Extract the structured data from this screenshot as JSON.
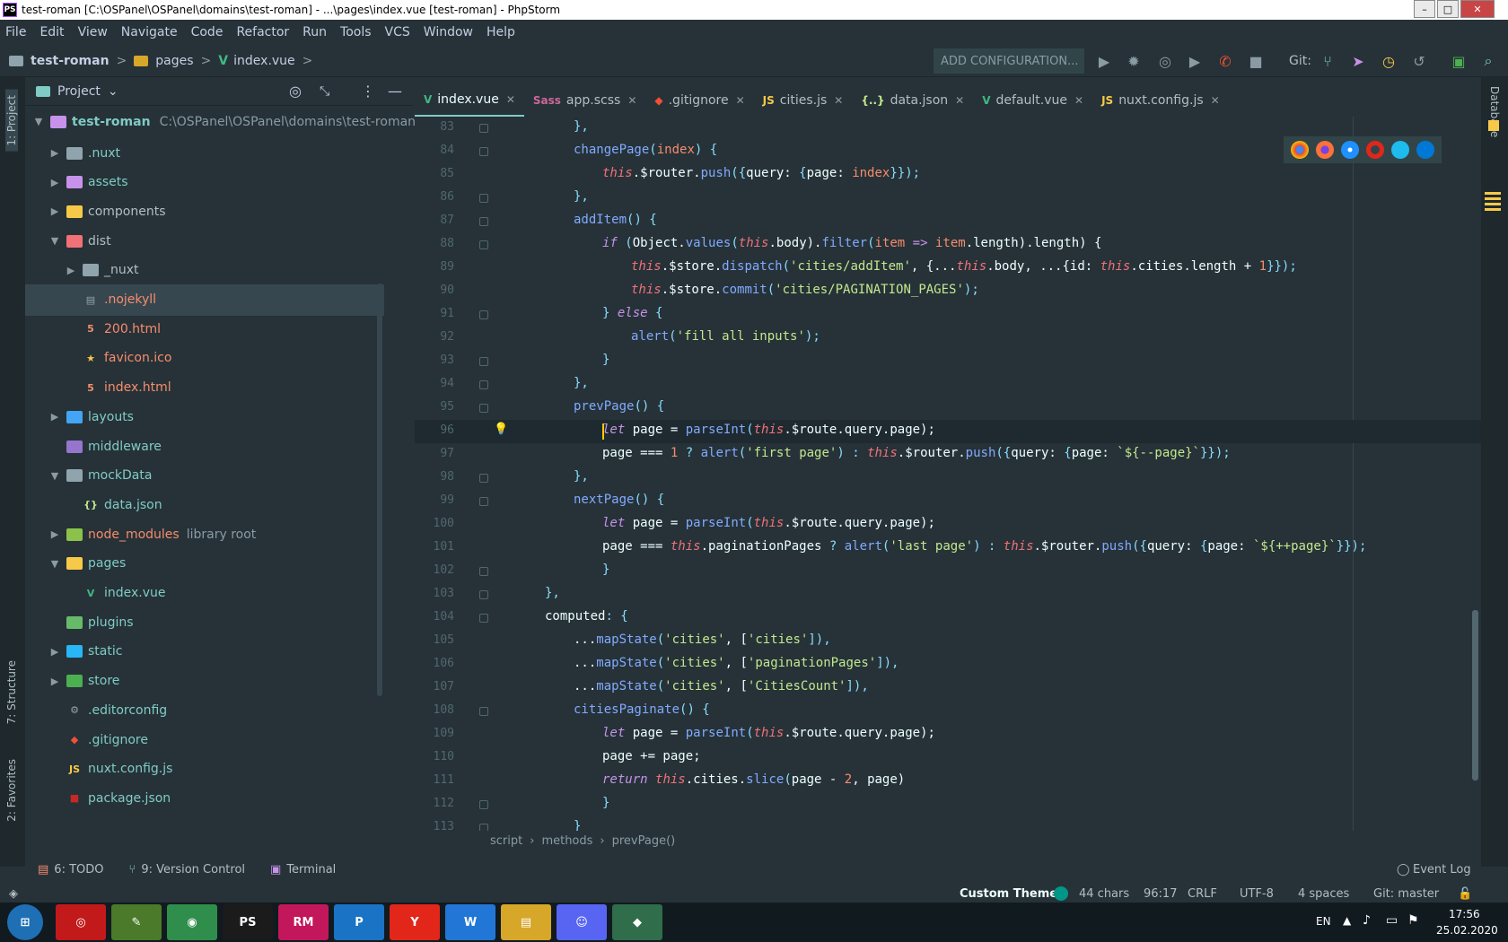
{
  "window": {
    "title": "test-roman [C:\\OSPanel\\OSPanel\\domains\\test-roman] - ...\\pages\\index.vue [test-roman] - PhpStorm",
    "logo": "PS",
    "minimize": "–",
    "maximize": "□",
    "close": "✕"
  },
  "menu": [
    "File",
    "Edit",
    "View",
    "Navigate",
    "Code",
    "Refactor",
    "Run",
    "Tools",
    "VCS",
    "Window",
    "Help"
  ],
  "nav": {
    "project": "test-roman",
    "folder": "pages",
    "file": "index.vue",
    "run_config": "ADD CONFIGURATION...",
    "git_label": "Git:"
  },
  "side_strip": {
    "project_label": "1: Project",
    "structure_label": "7: Structure",
    "favorites_label": "2: Favorites",
    "database_label": "Database"
  },
  "project_panel": {
    "title": "Project",
    "root_name": "test-roman",
    "root_path": "C:\\OSPanel\\OSPanel\\domains\\test-roman",
    "items": [
      {
        "label": "nuxt_label",
        "text": ".nuxt",
        "depth": 1,
        "arrow": "right",
        "icon": "folder",
        "color": "#80cbc4"
      },
      {
        "text": "assets",
        "depth": 1,
        "arrow": "right",
        "icon": "folder-assets",
        "color": "#80cbc4"
      },
      {
        "text": "components",
        "depth": 1,
        "arrow": "right",
        "icon": "folder-components",
        "color": "#b0bec5"
      },
      {
        "text": "dist",
        "depth": 1,
        "arrow": "down",
        "icon": "folder-dist",
        "color": "#b0bec5"
      },
      {
        "text": "_nuxt",
        "depth": 2,
        "arrow": "right",
        "icon": "folder",
        "color": "#b0bec5"
      },
      {
        "text": ".nojekyll",
        "depth": 2,
        "arrow": "",
        "icon": "file",
        "color": "#f78c6c",
        "selected": true
      },
      {
        "text": "200.html",
        "depth": 2,
        "arrow": "",
        "icon": "html",
        "color": "#f78c6c"
      },
      {
        "text": "favicon.ico",
        "depth": 2,
        "arrow": "",
        "icon": "star",
        "color": "#f78c6c"
      },
      {
        "text": "index.html",
        "depth": 2,
        "arrow": "",
        "icon": "html",
        "color": "#f78c6c"
      },
      {
        "text": "layouts",
        "depth": 1,
        "arrow": "right",
        "icon": "folder-layouts",
        "color": "#80cbc4"
      },
      {
        "text": "middleware",
        "depth": 1,
        "arrow": "",
        "icon": "folder-middleware",
        "color": "#80cbc4"
      },
      {
        "text": "mockData",
        "depth": 1,
        "arrow": "down",
        "icon": "folder",
        "color": "#80cbc4"
      },
      {
        "text": "data.json",
        "depth": 2,
        "arrow": "",
        "icon": "json",
        "color": "#80cbc4"
      },
      {
        "text": "node_modules",
        "depth": 1,
        "arrow": "right",
        "icon": "folder-node",
        "color": "#f78c6c",
        "suffix": "library root"
      },
      {
        "text": "pages",
        "depth": 1,
        "arrow": "down",
        "icon": "folder-pages",
        "color": "#80cbc4"
      },
      {
        "text": "index.vue",
        "depth": 2,
        "arrow": "",
        "icon": "vue",
        "color": "#80cbc4"
      },
      {
        "text": "plugins",
        "depth": 1,
        "arrow": "",
        "icon": "folder-plugins",
        "color": "#80cbc4"
      },
      {
        "text": "static",
        "depth": 1,
        "arrow": "right",
        "icon": "folder-static",
        "color": "#80cbc4"
      },
      {
        "text": "store",
        "depth": 1,
        "arrow": "right",
        "icon": "folder-store",
        "color": "#80cbc4"
      },
      {
        "text": ".editorconfig",
        "depth": 1,
        "arrow": "",
        "icon": "config",
        "color": "#80cbc4"
      },
      {
        "text": ".gitignore",
        "depth": 1,
        "arrow": "",
        "icon": "git",
        "color": "#80cbc4"
      },
      {
        "text": "nuxt.config.js",
        "depth": 1,
        "arrow": "",
        "icon": "js",
        "color": "#80cbc4"
      },
      {
        "text": "package.json",
        "depth": 1,
        "arrow": "",
        "icon": "npm",
        "color": "#80cbc4"
      }
    ]
  },
  "tabs": [
    {
      "label": "index.vue",
      "icon": "vue-icon",
      "glyph": "V",
      "color": "#41b883",
      "active": true
    },
    {
      "label": "app.scss",
      "icon": "sass-icon",
      "glyph": "Sass",
      "color": "#cd6799"
    },
    {
      "label": ".gitignore",
      "icon": "git-icon",
      "glyph": "◆",
      "color": "#f05133"
    },
    {
      "label": "cities.js",
      "icon": "js-icon",
      "glyph": "JS",
      "color": "#f7c948"
    },
    {
      "label": "data.json",
      "icon": "json-icon",
      "glyph": "{..}",
      "color": "#c3e88d"
    },
    {
      "label": "default.vue",
      "icon": "vue-icon",
      "glyph": "V",
      "color": "#41b883"
    },
    {
      "label": "nuxt.config.js",
      "icon": "js-icon",
      "glyph": "JS",
      "color": "#f7c948"
    }
  ],
  "code": {
    "first_line": 83,
    "current_line": 96,
    "lines": [
      {
        "n": "83",
        "indent": 2,
        "html": "<span class=\"p\">},</span>"
      },
      {
        "n": "84",
        "indent": 2,
        "html": "<span class=\"f\">changePage</span><span class=\"p\">(</span><span class=\"pr\">index</span><span class=\"p\">) {</span>"
      },
      {
        "n": "85",
        "indent": 3,
        "html": "<span class=\"t\">this</span><span class=\"v\">.$router.</span><span class=\"f\">push</span><span class=\"p\">({</span><span class=\"v\">query: </span><span class=\"p\">{</span><span class=\"v\">page: </span><span class=\"pr\">index</span><span class=\"p\">}});</span>"
      },
      {
        "n": "86",
        "indent": 2,
        "html": "<span class=\"p\">},</span>"
      },
      {
        "n": "87",
        "indent": 2,
        "html": "<span class=\"f\">addItem</span><span class=\"p\">() {</span>"
      },
      {
        "n": "88",
        "indent": 3,
        "html": "<span class=\"k\">if</span> <span class=\"p\">(</span><span class=\"v\">Object.</span><span class=\"f\">values</span><span class=\"p\">(</span><span class=\"t\">this</span><span class=\"v\">.body).</span><span class=\"f\">filter</span><span class=\"p\">(</span><span class=\"pr\">item</span> <span class=\"kw\">=></span> <span class=\"pr\">item</span><span class=\"v\">.length).length) {</span>"
      },
      {
        "n": "89",
        "indent": 4,
        "html": "<span class=\"t\">this</span><span class=\"v\">.$store.</span><span class=\"f\">dispatch</span><span class=\"p\">(</span><span class=\"s\">'cities/addItem'</span><span class=\"v\">, {...</span><span class=\"t\">this</span><span class=\"v\">.body, ...{id: </span><span class=\"t\">this</span><span class=\"v\">.cities.length + </span><span class=\"n\">1</span><span class=\"p\">}});</span>"
      },
      {
        "n": "90",
        "indent": 4,
        "html": "<span class=\"t\">this</span><span class=\"v\">.$store.</span><span class=\"f\">commit</span><span class=\"p\">(</span><span class=\"s\">'cities/PAGINATION_PAGES'</span><span class=\"p\">);</span>"
      },
      {
        "n": "91",
        "indent": 3,
        "html": "<span class=\"p\">} </span><span class=\"k\">else</span><span class=\"p\"> {</span>"
      },
      {
        "n": "92",
        "indent": 4,
        "html": "<span class=\"f\">alert</span><span class=\"p\">(</span><span class=\"s\">'fill all inputs'</span><span class=\"p\">);</span>"
      },
      {
        "n": "93",
        "indent": 3,
        "html": "<span class=\"p\">}</span>"
      },
      {
        "n": "94",
        "indent": 2,
        "html": "<span class=\"p\">},</span>"
      },
      {
        "n": "95",
        "indent": 2,
        "html": "<span class=\"f\">prevPage</span><span class=\"p\">() {</span>"
      },
      {
        "n": "96",
        "indent": 3,
        "html": "<span class=\"k\">let</span> <span class=\"v\">page = </span><span class=\"f\">parseInt</span><span class=\"p\">(</span><span class=\"t\">this</span><span class=\"v\">.$route.query.page);</span>"
      },
      {
        "n": "97",
        "indent": 3,
        "html": "<span class=\"v\">page === </span><span class=\"n\">1</span> <span class=\"p\">?</span> <span class=\"f\">alert</span><span class=\"p\">(</span><span class=\"s\">'first page'</span><span class=\"p\">) : </span><span class=\"t\">this</span><span class=\"v\">.$router.</span><span class=\"f\">push</span><span class=\"p\">({</span><span class=\"v\">query: </span><span class=\"p\">{</span><span class=\"v\">page: </span><span class=\"s\">`${--page}`</span><span class=\"p\">}});</span>"
      },
      {
        "n": "98",
        "indent": 2,
        "html": "<span class=\"p\">},</span>"
      },
      {
        "n": "99",
        "indent": 2,
        "html": "<span class=\"f\">nextPage</span><span class=\"p\">() {</span>"
      },
      {
        "n": "100",
        "indent": 3,
        "html": "<span class=\"k\">let</span> <span class=\"v\">page = </span><span class=\"f\">parseInt</span><span class=\"p\">(</span><span class=\"t\">this</span><span class=\"v\">.$route.query.page);</span>"
      },
      {
        "n": "101",
        "indent": 3,
        "html": "<span class=\"v\">page === </span><span class=\"t\">this</span><span class=\"v\">.paginationPages </span><span class=\"p\">?</span> <span class=\"f\">alert</span><span class=\"p\">(</span><span class=\"s\">'last page'</span><span class=\"p\">) : </span><span class=\"t\">this</span><span class=\"v\">.$router.</span><span class=\"f\">push</span><span class=\"p\">({</span><span class=\"v\">query: </span><span class=\"p\">{</span><span class=\"v\">page: </span><span class=\"s\">`${++page}`</span><span class=\"p\">}});</span>"
      },
      {
        "n": "102",
        "indent": 3,
        "html": "<span class=\"p\">}</span>"
      },
      {
        "n": "103",
        "indent": 1,
        "html": "<span class=\"p\">},</span>"
      },
      {
        "n": "104",
        "indent": 1,
        "html": "<span class=\"v\">computed</span><span class=\"p\">: {</span>"
      },
      {
        "n": "105",
        "indent": 2,
        "html": "<span class=\"v\">...</span><span class=\"f\">mapState</span><span class=\"p\">(</span><span class=\"s\">'cities'</span><span class=\"v\">, [</span><span class=\"s\">'cities'</span><span class=\"p\">]),</span>"
      },
      {
        "n": "106",
        "indent": 2,
        "html": "<span class=\"v\">...</span><span class=\"f\">mapState</span><span class=\"p\">(</span><span class=\"s\">'cities'</span><span class=\"v\">, [</span><span class=\"s\">'paginationPages'</span><span class=\"p\">]),</span>"
      },
      {
        "n": "107",
        "indent": 2,
        "html": "<span class=\"v\">...</span><span class=\"f\">mapState</span><span class=\"p\">(</span><span class=\"s\">'cities'</span><span class=\"v\">, [</span><span class=\"s\">'CitiesCount'</span><span class=\"p\">]),</span>"
      },
      {
        "n": "108",
        "indent": 2,
        "html": "<span class=\"f\">citiesPaginate</span><span class=\"p\">() {</span>"
      },
      {
        "n": "109",
        "indent": 3,
        "html": "<span class=\"k\">let</span> <span class=\"v\">page = </span><span class=\"f\">parseInt</span><span class=\"p\">(</span><span class=\"t\">this</span><span class=\"v\">.$route.query.page);</span>"
      },
      {
        "n": "110",
        "indent": 3,
        "html": "<span class=\"v\">page += page;</span>"
      },
      {
        "n": "111",
        "indent": 3,
        "html": "<span class=\"k\">return</span> <span class=\"t\">this</span><span class=\"v\">.cities.</span><span class=\"f\">slice</span><span class=\"p\">(</span><span class=\"v\">page - </span><span class=\"n\">2</span><span class=\"v\">, page)</span>"
      },
      {
        "n": "112",
        "indent": 3,
        "html": "<span class=\"p\">}</span>"
      },
      {
        "n": "113",
        "indent": 2,
        "html": "<span class=\"p\">}</span>"
      }
    ]
  },
  "editor_breadcrumb": [
    "script",
    "methods",
    "prevPage()"
  ],
  "bottom_tools": {
    "todo": "6: TODO",
    "vcs": "9: Version Control",
    "terminal": "Terminal",
    "event_log": "Event Log"
  },
  "status": {
    "theme": "Custom Theme",
    "chars": "44 chars",
    "position": "96:17",
    "line_sep": "CRLF",
    "encoding": "UTF-8",
    "indent": "4 spaces",
    "git": "Git: master"
  },
  "taskbar": {
    "lang": "EN",
    "time": "17:56",
    "date": "25.02.2020",
    "apps": [
      {
        "name": "windows-start-icon",
        "glyph": "⊞",
        "bg": "#1f6fb5"
      },
      {
        "name": "adobe-cc-icon",
        "glyph": "◎",
        "bg": "#c21a1a"
      },
      {
        "name": "editor-icon",
        "glyph": "✎",
        "bg": "#4a7a2a"
      },
      {
        "name": "chrome-icon",
        "glyph": "◉",
        "bg": "#2f8e4b"
      },
      {
        "name": "phpstorm-icon",
        "glyph": "PS",
        "bg": "#1b1b1b"
      },
      {
        "name": "rubymine-icon",
        "glyph": "RM",
        "bg": "#c2185b"
      },
      {
        "name": "p-app-icon",
        "glyph": "P",
        "bg": "#1a73c5"
      },
      {
        "name": "yandex-icon",
        "glyph": "Y",
        "bg": "#e3261a"
      },
      {
        "name": "w-app-icon",
        "glyph": "W",
        "bg": "#2277d6"
      },
      {
        "name": "explorer-icon",
        "glyph": "▤",
        "bg": "#d7a72a"
      },
      {
        "name": "discord-icon",
        "glyph": "☺",
        "bg": "#5865f2"
      },
      {
        "name": "git-app-icon",
        "glyph": "◆",
        "bg": "#2f6d4b"
      }
    ]
  }
}
